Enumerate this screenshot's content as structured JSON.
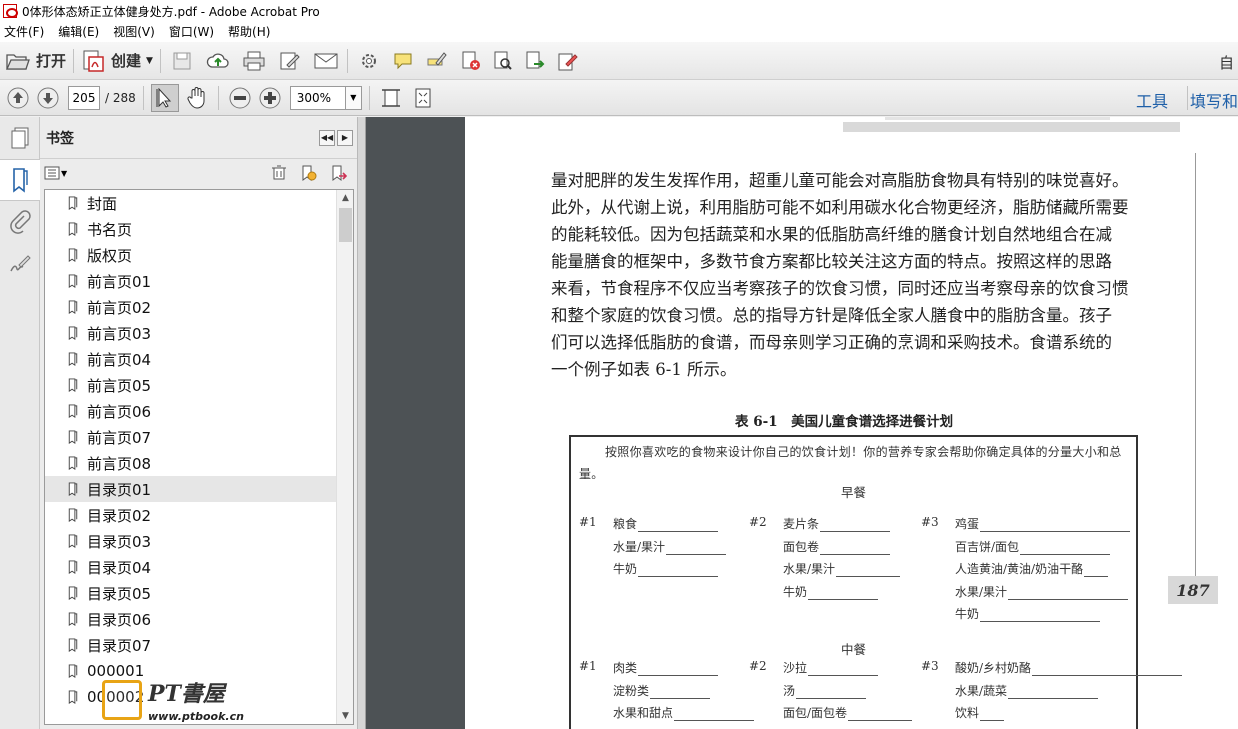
{
  "window": {
    "title": "0体形体态矫正立体健身处方.pdf - Adobe Acrobat Pro"
  },
  "menubar": {
    "items": [
      "文件(F)",
      "编辑(E)",
      "视图(V)",
      "窗口(W)",
      "帮助(H)"
    ]
  },
  "toolbar": {
    "open_label": "打开",
    "create_label": "创建",
    "right_label": "自"
  },
  "nav": {
    "current_page": "205",
    "total_pages": "/ 288",
    "zoom": "300%",
    "tools_link": "工具",
    "fill_link": "填写和"
  },
  "panel": {
    "title": "书签",
    "bookmarks": [
      "封面",
      "书名页",
      "版权页",
      "前言页01",
      "前言页02",
      "前言页03",
      "前言页04",
      "前言页05",
      "前言页06",
      "前言页07",
      "前言页08",
      "目录页01",
      "目录页02",
      "目录页03",
      "目录页04",
      "目录页05",
      "目录页06",
      "目录页07",
      "000001",
      "000002"
    ],
    "selected_index": 11
  },
  "page": {
    "paragraph_lines": [
      "量对肥胖的发生发挥作用，超重儿童可能会对高脂肪食物具有特别的味觉喜好。",
      "此外，从代谢上说，利用脂肪可能不如利用碳水化合物更经济，脂肪储藏所需要",
      "的能耗较低。因为包括蔬菜和水果的低脂肪高纤维的膳食计划自然地组合在减",
      "能量膳食的框架中，多数节食方案都比较关注这方面的特点。按照这样的思路",
      "来看，节食程序不仅应当考察孩子的饮食习惯，同时还应当考察母亲的饮食习惯",
      "和整个家庭的饮食习惯。总的指导方针是降低全家人膳食中的脂肪含量。孩子",
      "们可以选择低脂肪的食谱，而母亲则学习正确的烹调和采购技术。食谱系统的",
      "一个例子如表 6-1 所示。"
    ],
    "table_caption": "表 6-1　美国儿童食谱选择进餐计划",
    "intro": "按照你喜欢吃的食物来设计你自己的饮食计划！你的营养专家会帮助你确定具体的分量大小和总量。",
    "breakfast_title": "早餐",
    "lunch_title": "中餐",
    "breakfast": [
      {
        "label": "#1",
        "items": [
          "粮食",
          "水量/果汁",
          "牛奶"
        ]
      },
      {
        "label": "#2",
        "items": [
          "麦片条",
          "面包卷",
          "水果/果汁",
          "牛奶"
        ]
      },
      {
        "label": "#3",
        "items": [
          "鸡蛋",
          "百吉饼/面包",
          "人造黄油/黄油/奶油干酪",
          "水果/果汁",
          "牛奶"
        ]
      }
    ],
    "lunch": [
      {
        "label": "#1",
        "items": [
          "肉类",
          "淀粉类",
          "水果和甜点"
        ]
      },
      {
        "label": "#2",
        "items": [
          "沙拉",
          "汤",
          "面包/面包卷"
        ]
      },
      {
        "label": "#3",
        "items": [
          "酸奶/乡村奶酪",
          "水果/蔬菜",
          "饮料"
        ]
      }
    ],
    "page_number": "187"
  },
  "watermark": {
    "text": "PT書屋",
    "url": "www.ptbook.cn"
  }
}
